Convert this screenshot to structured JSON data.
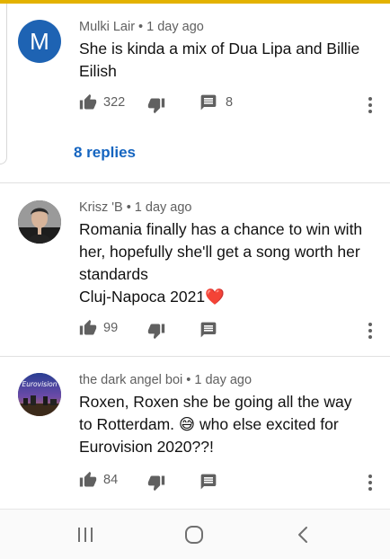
{
  "comments": [
    {
      "author": "Mulki Lair",
      "age": "1 day ago",
      "avatar_letter": "M",
      "text_lines": [
        "She is kinda a mix of Dua Lipa and Billie",
        "Eilish"
      ],
      "likes": "322",
      "reply_count": "8",
      "replies_link": "8 replies"
    },
    {
      "author": "Krisz 'B",
      "age": "1 day ago",
      "text_lines": [
        "Romania finally has a chance to win with",
        "her, hopefully she'll get a song worth her",
        "standards",
        "Cluj-Napoca 2021"
      ],
      "emoji": "❤️",
      "likes": "99"
    },
    {
      "author": "the dark angel boi",
      "age": "1 day ago",
      "text_lines": [
        "Roxen, Roxen she be going all the way",
        "to Rotterdam. ",
        "who else excited for",
        "Eurovision 2020??!"
      ],
      "emoji": "😅",
      "avatar_text": "Eurovision",
      "likes": "84"
    }
  ],
  "colors": {
    "top_accent": "#e3b200",
    "avatar_m": "#1e63b3",
    "link": "#1565c0",
    "meta": "#606060"
  },
  "icons": [
    "like-icon",
    "dislike-icon",
    "reply-icon",
    "more-vert-icon",
    "recent-apps-icon",
    "home-icon",
    "back-icon"
  ]
}
